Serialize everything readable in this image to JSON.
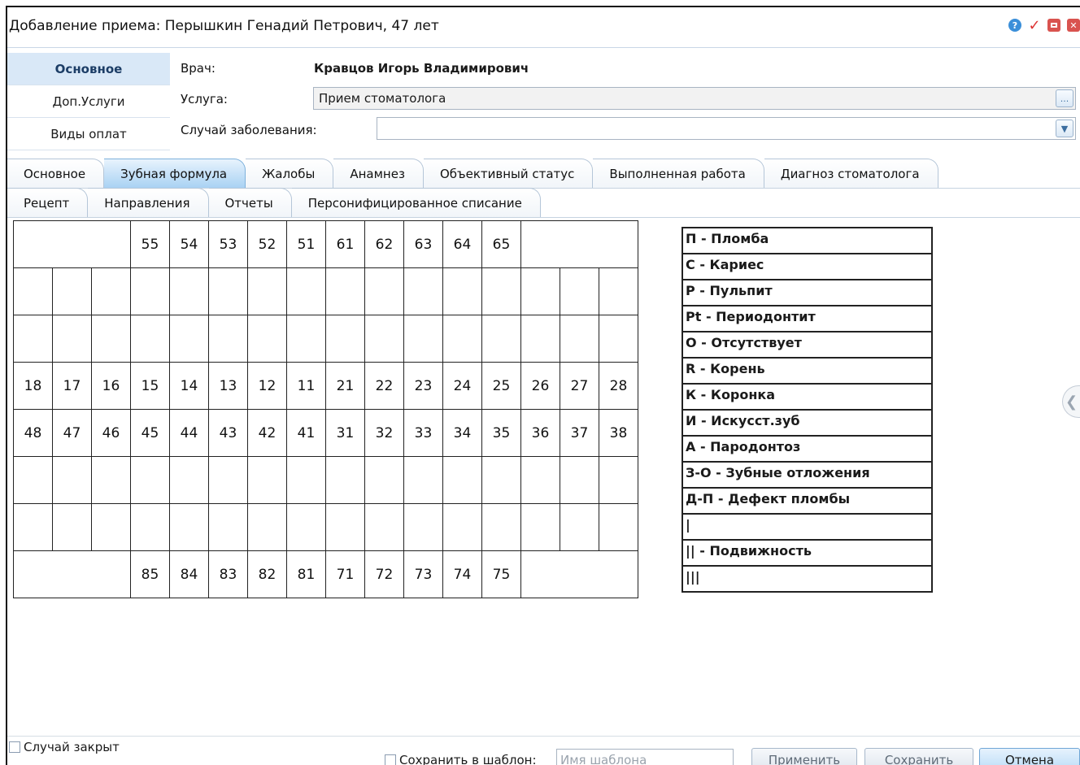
{
  "window": {
    "title": "Добавление приема: Перышкин Генадий Петрович, 47 лет",
    "icons": [
      "help-icon",
      "check-icon",
      "minimize-icon",
      "close-icon"
    ]
  },
  "left_nav": [
    {
      "label": "Основное",
      "active": true
    },
    {
      "label": "Доп.Услуги",
      "active": false
    },
    {
      "label": "Виды оплат",
      "active": false
    }
  ],
  "header": {
    "doctor_label": "Врач:",
    "doctor_value": "Кравцов Игорь Владимирович",
    "service_label": "Услуга:",
    "service_value": "Прием стоматолога",
    "service_button": "...",
    "case_label": "Случай заболевания:",
    "case_value": ""
  },
  "tabs_row1": [
    {
      "label": "Основное",
      "active": false
    },
    {
      "label": "Зубная формула",
      "active": true
    },
    {
      "label": "Жалобы",
      "active": false
    },
    {
      "label": "Анамнез",
      "active": false
    },
    {
      "label": "Объективный статус",
      "active": false
    },
    {
      "label": "Выполненная работа",
      "active": false
    },
    {
      "label": "Диагноз стоматолога",
      "active": false
    }
  ],
  "tabs_row2": [
    {
      "label": "Рецепт",
      "active": false
    },
    {
      "label": "Направления",
      "active": false
    },
    {
      "label": "Отчеты",
      "active": false
    },
    {
      "label": "Персонифицированное списание",
      "active": false
    }
  ],
  "teeth": {
    "primary_upper": [
      "55",
      "54",
      "53",
      "52",
      "51",
      "61",
      "62",
      "63",
      "64",
      "65"
    ],
    "permanent_upper": [
      "18",
      "17",
      "16",
      "15",
      "14",
      "13",
      "12",
      "11",
      "21",
      "22",
      "23",
      "24",
      "25",
      "26",
      "27",
      "28"
    ],
    "permanent_lower": [
      "48",
      "47",
      "46",
      "45",
      "44",
      "43",
      "42",
      "41",
      "31",
      "32",
      "33",
      "34",
      "35",
      "36",
      "37",
      "38"
    ],
    "primary_lower": [
      "85",
      "84",
      "83",
      "82",
      "81",
      "71",
      "72",
      "73",
      "74",
      "75"
    ]
  },
  "legend": [
    "П - Пломба",
    "С - Кариес",
    "Р - Пульпит",
    "Pt - Периодонтит",
    "О - Отсутствует",
    "R - Корень",
    "К - Коронка",
    "И - Искусст.зуб",
    "А - Пародонтоз",
    "З-О - Зубные отложения",
    "Д-П - Дефект пломбы",
    "|",
    "|| - Подвижность",
    "|||"
  ],
  "footer": {
    "case_closed_label": "Случай закрыт",
    "save_template_label": "Сохранить в шаблон:",
    "template_placeholder": "Имя шаблона",
    "apply_button": "Применить",
    "save_button": "Сохранить",
    "cancel_button": "Отмена"
  }
}
